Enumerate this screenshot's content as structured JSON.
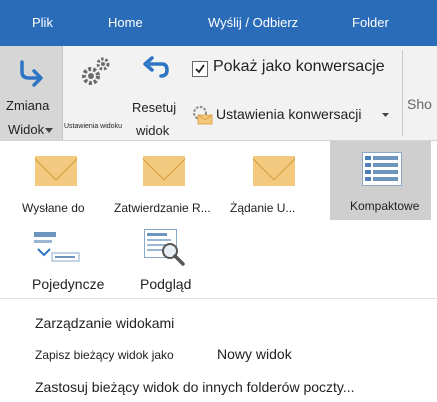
{
  "tabs": [
    "Plik",
    "Home",
    "Wyślij / Odbierz",
    "Folder"
  ],
  "ribbon": {
    "change_view": [
      "Zmiana",
      "Widok"
    ],
    "view_settings": "Ustawienia widoku",
    "reset_view": [
      "Resetuj",
      "widok"
    ],
    "show_as_conversations": "Pokaż jako konwersacje",
    "show_as_conversations_checked": true,
    "conversation_settings": "Ustawienia konwersacji",
    "cut_off": "Sho"
  },
  "views": [
    {
      "label": "Wysłane do",
      "icon": "envelope-icon"
    },
    {
      "label": "Zatwierdzanie R...",
      "icon": "envelope-icon"
    },
    {
      "label": "Żądanie U...",
      "icon": "envelope-icon"
    },
    {
      "label": "Kompaktowe",
      "icon": "compact-list-icon",
      "selected": true
    },
    {
      "label": "Pojedyncze",
      "icon": "single-view-icon"
    },
    {
      "label": "Podgląd",
      "icon": "preview-icon"
    }
  ],
  "menu": {
    "manage_views": "Zarządzanie widokami",
    "save_view_as": "Zapisz bieżący widok jako",
    "new_view": "Nowy widok",
    "apply_view": "Zastosuj bieżący widok do innych folderów poczty..."
  },
  "colors": {
    "accent": "#2b6cb8",
    "selected": "#cfcfcf",
    "envelope": "#f2c97e"
  }
}
